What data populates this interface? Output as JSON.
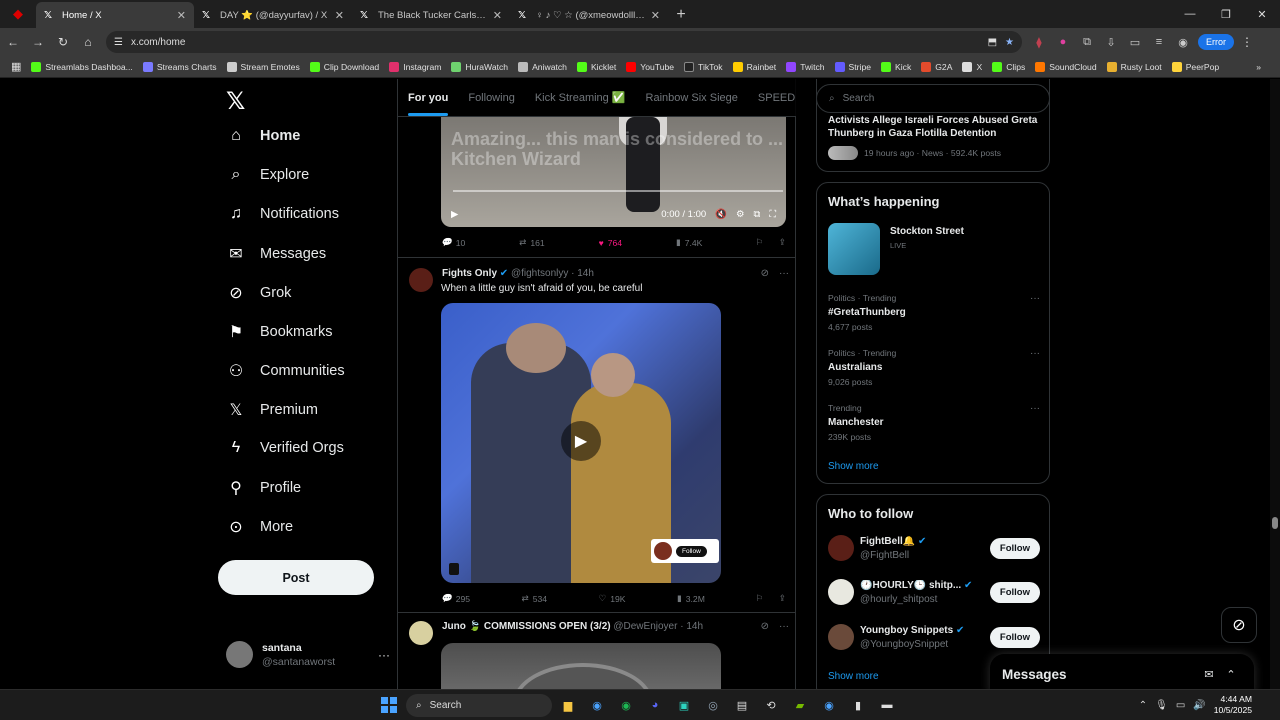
{
  "browser": {
    "tabs": [
      {
        "label": "Home / X",
        "active": true
      },
      {
        "label": "DAY ⭐ (@dayyurfav) / X",
        "active": false
      },
      {
        "label": "The Black Tucker Carlson Jr us",
        "active": false
      },
      {
        "label": "♀ ♪ ♡ ☆ (@xmeowdolll) / X",
        "active": false
      }
    ],
    "url": "x.com/home",
    "error_label": "Error",
    "bookmarks": [
      "Streamlabs Dashboa...",
      "Streams Charts",
      "Stream Emotes",
      "Clip Download",
      "Instagram",
      "HuraWatch",
      "Aniwatch",
      "Kicklet",
      "YouTube",
      "TikTok",
      "Rainbet",
      "Twitch",
      "Stripe",
      "Kick",
      "G2A",
      "X",
      "Clips",
      "SoundCloud",
      "Rusty Loot",
      "PeerPop"
    ]
  },
  "nav": {
    "items": [
      {
        "label": "Home",
        "icon": "home-icon"
      },
      {
        "label": "Explore",
        "icon": "search-icon"
      },
      {
        "label": "Notifications",
        "icon": "bell-icon"
      },
      {
        "label": "Messages",
        "icon": "mail-icon"
      },
      {
        "label": "Grok",
        "icon": "grok-icon"
      },
      {
        "label": "Bookmarks",
        "icon": "bookmark-icon"
      },
      {
        "label": "Communities",
        "icon": "people-icon"
      },
      {
        "label": "Premium",
        "icon": "x-icon"
      },
      {
        "label": "Verified Orgs",
        "icon": "lightning-icon"
      },
      {
        "label": "Profile",
        "icon": "person-icon"
      },
      {
        "label": "More",
        "icon": "more-icon"
      }
    ],
    "post_label": "Post",
    "account": {
      "name": "santana",
      "handle": "@santanaworst"
    }
  },
  "feed": {
    "tabs": [
      "For you",
      "Following",
      "Kick Streaming ✅",
      "Rainbow Six Siege",
      "SPEED GANG"
    ],
    "video1": {
      "overlay_text": "Amazing... this man is considered to ... Kitchen Wizard",
      "time": "0:00 / 1:00",
      "stats": {
        "replies": "10",
        "reposts": "161",
        "likes": "764",
        "views": "7.4K"
      }
    },
    "tweet2": {
      "author": "Fights Only",
      "handle": "@fightsonlyy",
      "age": "14h",
      "text": "When a little guy isn't afraid of you, be careful",
      "watermark_follow": "Follow",
      "stats": {
        "replies": "295",
        "reposts": "534",
        "likes": "19K",
        "views": "3.2M"
      }
    },
    "tweet3": {
      "author": "Juno 🍃 COMMISSIONS OPEN (3/2)",
      "handle": "@DewEnjoyer",
      "age": "14h"
    }
  },
  "right": {
    "search_placeholder": "Search",
    "news": {
      "title": "Activists Allege Israeli Forces Abused Greta Thunberg in Gaza Flotilla Detention",
      "meta": "19 hours ago · News · 592.4K posts"
    },
    "happening": {
      "title": "What’s happening",
      "live_title": "Stockton Street",
      "live_label": "LIVE",
      "trends": [
        {
          "category": "Politics · Trending",
          "name": "#GretaThunberg",
          "count": "4,677 posts"
        },
        {
          "category": "Politics · Trending",
          "name": "Australians",
          "count": "9,026 posts"
        },
        {
          "category": "Trending",
          "name": "Manchester",
          "count": "239K posts"
        }
      ],
      "show_more": "Show more"
    },
    "who_to_follow": {
      "title": "Who to follow",
      "users": [
        {
          "name": "FightBell🔔",
          "handle": "@FightBell"
        },
        {
          "name": "🕐HOURLY🕒 shitp...",
          "handle": "@hourly_shitpost"
        },
        {
          "name": "Youngboy Snippets",
          "handle": "@YoungboySnippet"
        }
      ],
      "follow_label": "Follow",
      "show_more": "Show more"
    },
    "messages_title": "Messages"
  },
  "taskbar": {
    "search_label": "Search",
    "time": "4:44 AM",
    "date": "10/5/2025"
  }
}
